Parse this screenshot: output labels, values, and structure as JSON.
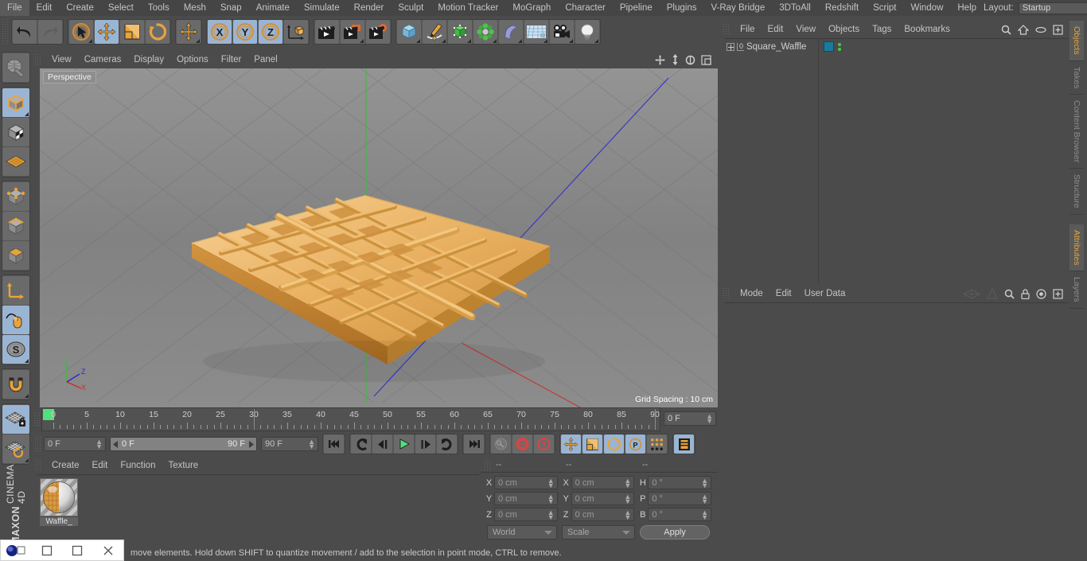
{
  "menubar": {
    "items": [
      "File",
      "Edit",
      "Create",
      "Select",
      "Tools",
      "Mesh",
      "Snap",
      "Animate",
      "Simulate",
      "Render",
      "Sculpt",
      "Motion Tracker",
      "MoGraph",
      "Character",
      "Pipeline",
      "Plugins",
      "V-Ray Bridge",
      "3DToAll",
      "Redshift",
      "Script",
      "Window",
      "Help"
    ],
    "layout_label": "Layout:",
    "layout_value": "Startup",
    "search_icon": "search-icon"
  },
  "toolbar": {
    "groups": [
      {
        "name": "undo-redo",
        "buttons": [
          {
            "name": "undo-button",
            "icon": "undo-arrow-icon",
            "active": false
          },
          {
            "name": "redo-button",
            "icon": "redo-arrow-icon",
            "active": false,
            "disabled": true
          }
        ]
      },
      {
        "name": "selection-tools",
        "buttons": [
          {
            "name": "live-selection-button",
            "icon": "cursor-circle-icon",
            "active": false,
            "corner": true
          },
          {
            "name": "move-tool-button",
            "icon": "move-arrows-icon",
            "active": true
          },
          {
            "name": "scale-tool-button",
            "icon": "scale-box-icon",
            "active": false
          },
          {
            "name": "rotate-tool-button",
            "icon": "rotate-circle-icon",
            "active": false
          }
        ]
      },
      {
        "name": "move-dup",
        "buttons": [
          {
            "name": "move-duplicate-button",
            "icon": "move-arrows-icon",
            "active": false,
            "corner": true
          }
        ]
      },
      {
        "name": "axis-locks",
        "buttons": [
          {
            "name": "lock-x-button",
            "icon": "x-axis-icon",
            "label": "X",
            "active": true
          },
          {
            "name": "lock-y-button",
            "icon": "y-axis-icon",
            "label": "Y",
            "active": true
          },
          {
            "name": "lock-z-button",
            "icon": "z-axis-icon",
            "label": "Z",
            "active": true
          },
          {
            "name": "world-object-axis-button",
            "icon": "world-axis-cube-icon",
            "active": false
          }
        ]
      },
      {
        "name": "render-tools",
        "buttons": [
          {
            "name": "render-view-button",
            "icon": "clapper-icon",
            "active": false,
            "corner": false
          },
          {
            "name": "render-region-button",
            "icon": "clapper-region-icon",
            "active": false,
            "corner": true
          },
          {
            "name": "render-settings-button",
            "icon": "clapper-gear-icon",
            "active": false
          }
        ]
      },
      {
        "name": "primitives",
        "buttons": [
          {
            "name": "add-cube-button",
            "icon": "cube-icon",
            "active": false,
            "corner": true
          },
          {
            "name": "add-spline-button",
            "icon": "pen-spline-icon",
            "active": false,
            "corner": true
          },
          {
            "name": "add-nurbs-button",
            "icon": "subdivision-cube-icon",
            "active": false,
            "corner": true
          },
          {
            "name": "add-array-button",
            "icon": "array-green-icon",
            "active": false,
            "corner": true
          },
          {
            "name": "add-deformer-button",
            "icon": "bend-deformer-icon",
            "active": false,
            "corner": true
          },
          {
            "name": "add-environment-button",
            "icon": "floor-grid-icon",
            "active": false,
            "corner": true
          },
          {
            "name": "add-camera-button",
            "icon": "camera-icon",
            "active": false,
            "corner": true
          },
          {
            "name": "add-light-button",
            "icon": "light-bulb-icon",
            "active": false,
            "corner": true
          }
        ]
      }
    ]
  },
  "left_toolbar": {
    "buttons": [
      {
        "name": "make-editable-button",
        "icon": "globe-mesh-icon",
        "active": false
      },
      {
        "name": "model-mode-button",
        "icon": "model-cube-icon",
        "active": true,
        "corner": true
      },
      {
        "name": "texture-mode-button",
        "icon": "texture-cube-icon",
        "active": false
      },
      {
        "name": "workplane-mode-button",
        "icon": "workplane-grid-icon",
        "active": false
      },
      {
        "name": "point-mode-button",
        "icon": "points-cube-icon",
        "active": false
      },
      {
        "name": "edge-mode-button",
        "icon": "edge-cube-icon",
        "active": false
      },
      {
        "name": "polygon-mode-button",
        "icon": "polygon-cube-icon",
        "active": false
      },
      {
        "name": "object-axis-button",
        "icon": "axis-arrows-icon",
        "active": false
      },
      {
        "name": "viewport-solo-button",
        "icon": "mouse-spline-icon",
        "active": true
      },
      {
        "name": "soft-selection-button",
        "icon": "s-circle-icon",
        "active": true,
        "corner": true
      },
      {
        "name": "snap-magnet-button",
        "icon": "magnet-icon",
        "active": false,
        "corner": true
      },
      {
        "name": "workplane-lock-button",
        "icon": "grid-lock-icon",
        "active": true
      },
      {
        "name": "workplane-align-button",
        "icon": "grid-rotate-icon",
        "active": false,
        "corner": true
      }
    ],
    "brand_top": "MAXON",
    "brand_bottom": "CINEMA 4D"
  },
  "viewport": {
    "menu_items": [
      "View",
      "Cameras",
      "Display",
      "Options",
      "Filter",
      "Panel"
    ],
    "corner_icons": [
      "pan-icon",
      "zoom-icon",
      "rotate-icon",
      "maximize-icon"
    ],
    "label": "Perspective",
    "grid_spacing": "Grid Spacing : 10 cm",
    "axis_labels": {
      "x": "X",
      "y": "Y",
      "z": "Z"
    }
  },
  "object_manager": {
    "menu_items": [
      "File",
      "Edit",
      "View",
      "Objects",
      "Tags",
      "Bookmarks"
    ],
    "header_icons": [
      "search-icon",
      "home-icon",
      "ellipse-icon",
      "add-layer-icon"
    ],
    "objects": [
      {
        "name": "Square_Waffle",
        "level_badge": "0",
        "tag_color": "#1c7a9c",
        "visible": true
      }
    ]
  },
  "attribute_manager": {
    "menu_items": [
      "Mode",
      "Edit",
      "User Data"
    ],
    "header_icons": [
      "animate-left-icon",
      "animate-right-icon",
      "search-icon",
      "lock-icon",
      "target-icon",
      "add-icon"
    ]
  },
  "right_dock": {
    "top_tabs": [
      {
        "label": "Objects",
        "active": true
      },
      {
        "label": "Takes",
        "active": false
      },
      {
        "label": "Content Browser",
        "active": false
      },
      {
        "label": "Structure",
        "active": false
      }
    ],
    "bottom_tabs": [
      {
        "label": "Attributes",
        "active": true
      },
      {
        "label": "Layers",
        "active": false
      }
    ]
  },
  "timeline": {
    "tick_labels": [
      "0",
      "5",
      "10",
      "15",
      "20",
      "25",
      "30",
      "35",
      "40",
      "45",
      "50",
      "55",
      "60",
      "65",
      "70",
      "75",
      "80",
      "85",
      "90"
    ],
    "min_frame": 0,
    "max_frame": 90,
    "current_frame": 0,
    "current_frame_field": "0 F"
  },
  "animation_bar": {
    "current_frame_field": "0 F",
    "range_start": "0 F",
    "range_end": "90 F",
    "max_frame_field": "90 F",
    "transport": [
      {
        "name": "go-to-start-button",
        "icon": "skip-start-icon"
      },
      {
        "name": "play-backwards-button",
        "icon": "rewind-icon"
      },
      {
        "name": "step-back-button",
        "icon": "step-back-icon"
      },
      {
        "name": "play-button",
        "icon": "play-icon"
      },
      {
        "name": "step-forward-button",
        "icon": "step-forward-icon"
      },
      {
        "name": "play-forwards-button",
        "icon": "forward-icon"
      },
      {
        "name": "go-to-end-button",
        "icon": "skip-end-icon"
      }
    ],
    "keyframe_buttons": [
      {
        "name": "autokey-button",
        "icon": "key-icon"
      },
      {
        "name": "record-button",
        "icon": "record-circle-icon"
      },
      {
        "name": "keyframe-selection-button",
        "icon": "record-question-icon"
      }
    ],
    "param_buttons": [
      {
        "name": "key-position-button",
        "icon": "move-arrows-icon",
        "active": true
      },
      {
        "name": "key-scale-button",
        "icon": "scale-box-icon",
        "active": true
      },
      {
        "name": "key-rotation-button",
        "icon": "rotate-circle-icon",
        "active": true
      },
      {
        "name": "key-parameter-button",
        "icon": "p-circle-icon",
        "active": true
      },
      {
        "name": "key-pla-button",
        "icon": "dots-grid-icon",
        "active": false
      },
      {
        "name": "timeline-button",
        "icon": "film-strip-icon",
        "active": true
      }
    ]
  },
  "material_manager": {
    "menu_items": [
      "Create",
      "Edit",
      "Function",
      "Texture"
    ],
    "materials": [
      {
        "name": "Waffle_",
        "type": "sphere-preview"
      }
    ]
  },
  "coordinate_manager": {
    "headers": [
      "--",
      "--",
      "--"
    ],
    "rows": [
      {
        "pos_label": "X",
        "pos_value": "0 cm",
        "size_label": "X",
        "size_value": "0 cm",
        "rot_label": "H",
        "rot_value": "0 °"
      },
      {
        "pos_label": "Y",
        "pos_value": "0 cm",
        "size_label": "Y",
        "size_value": "0 cm",
        "rot_label": "P",
        "rot_value": "0 °"
      },
      {
        "pos_label": "Z",
        "pos_value": "0 cm",
        "size_label": "Z",
        "size_value": "0 cm",
        "rot_label": "B",
        "rot_value": "0 °"
      }
    ],
    "coord_system": "World",
    "transform_mode": "Scale",
    "apply_label": "Apply"
  },
  "status_bar": {
    "text": "move elements. Hold down SHIFT to quantize movement / add to the selection in point mode, CTRL to remove."
  },
  "taskbar": {
    "items": [
      "app-icon",
      "minimize-icon",
      "maximize-icon",
      "close-icon"
    ]
  },
  "colors": {
    "accent_orange": "#e2a33c",
    "active_blue": "#9ab5d4",
    "panel_bg": "#4b4b4b",
    "waffle": "#e0a452"
  }
}
